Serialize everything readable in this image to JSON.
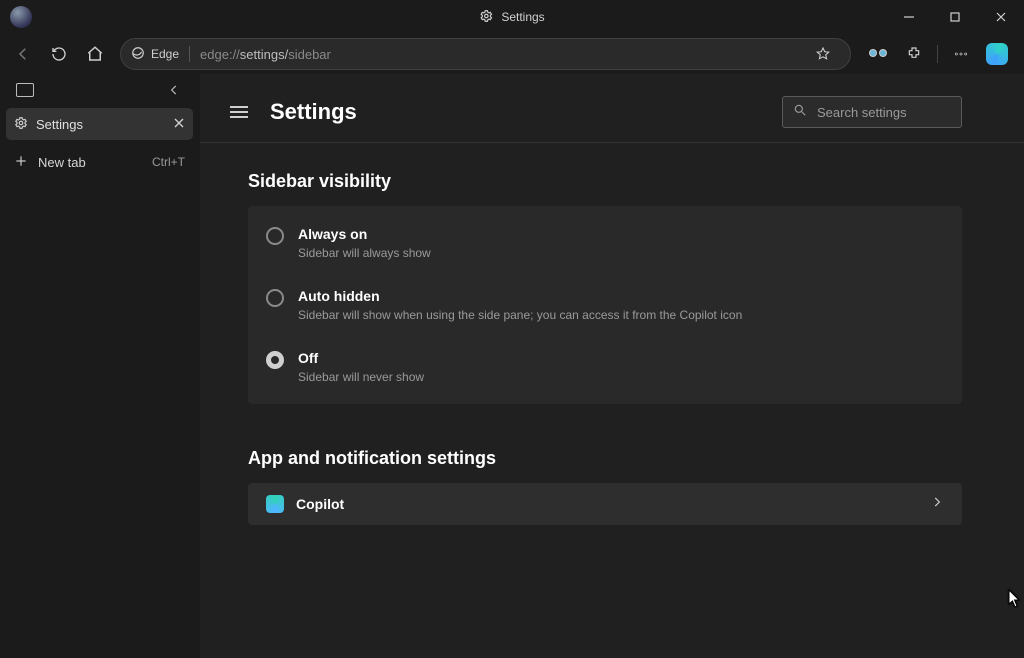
{
  "window": {
    "title": "Settings"
  },
  "toolbar": {
    "edge_chip": "Edge",
    "url_prefix": "edge://",
    "url_middle": "settings/",
    "url_suffix": "sidebar"
  },
  "vertical_tabs": {
    "active_tab_label": "Settings",
    "new_tab_label": "New tab",
    "new_tab_shortcut": "Ctrl+T"
  },
  "settings": {
    "page_title": "Settings",
    "search_placeholder": "Search settings",
    "section1_title": "Sidebar visibility",
    "options": [
      {
        "label": "Always on",
        "desc": "Sidebar will always show",
        "selected": false
      },
      {
        "label": "Auto hidden",
        "desc": "Sidebar will show when using the side pane; you can access it from the Copilot icon",
        "selected": false
      },
      {
        "label": "Off",
        "desc": "Sidebar will never show",
        "selected": true
      }
    ],
    "section2_title": "App and notification settings",
    "apps": [
      {
        "label": "Copilot"
      }
    ]
  }
}
